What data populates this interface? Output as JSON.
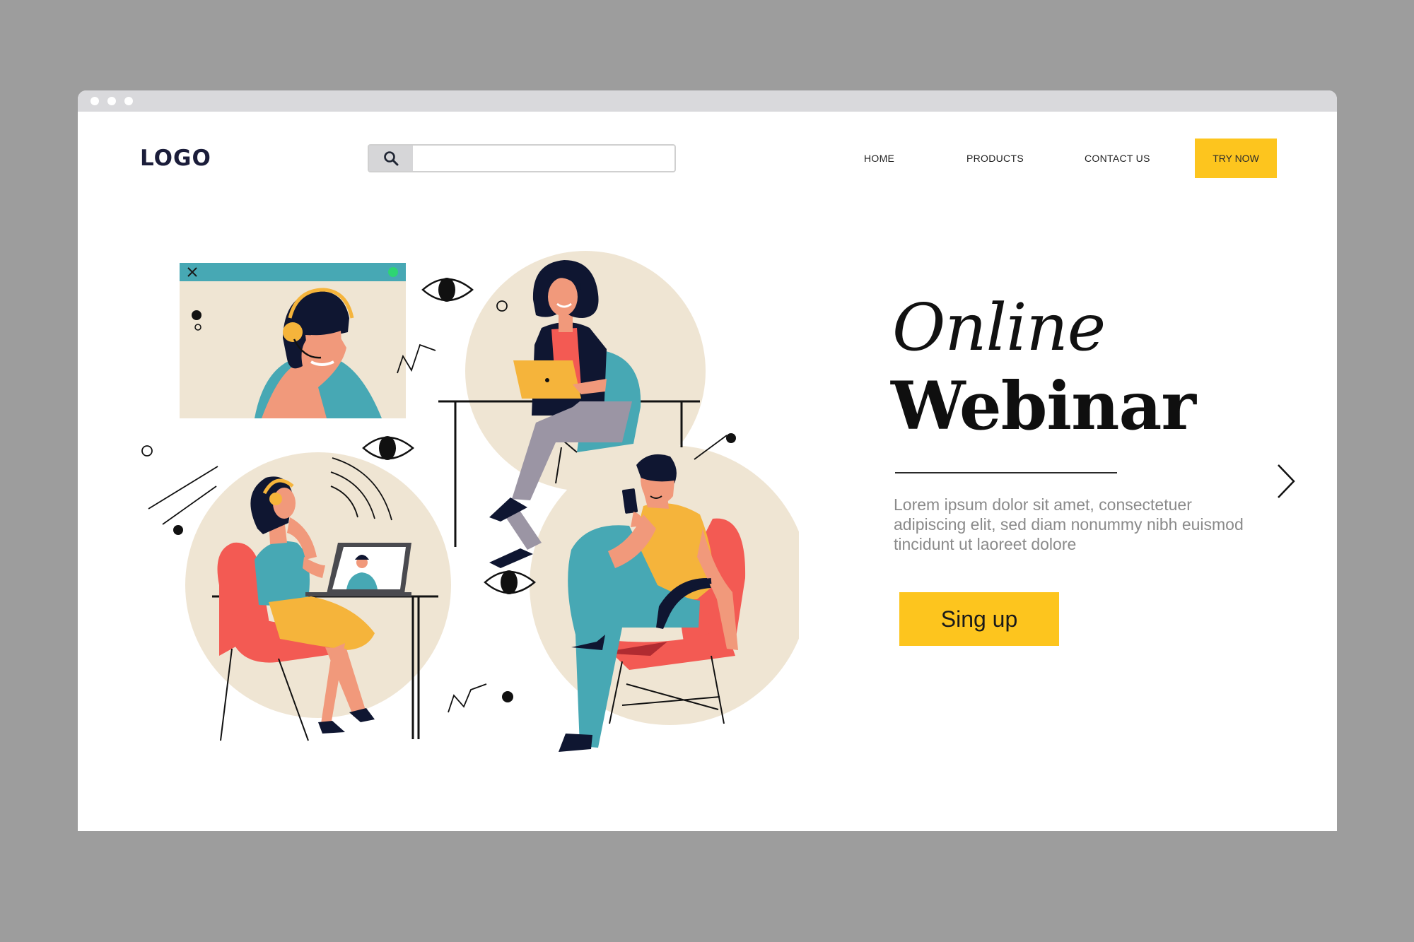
{
  "header": {
    "logo": "LOGO",
    "search": {
      "placeholder": ""
    },
    "nav": [
      {
        "label": "HOME"
      },
      {
        "label": "PRODUCTS"
      },
      {
        "label": "CONTACT US"
      }
    ],
    "cta": "TRY NOW"
  },
  "hero": {
    "title_line1": "Online",
    "title_line2": "Webinar",
    "description": "Lorem ipsum dolor sit amet, consectetuer adipiscing elit, sed diam nonummy nibh euismod tincidunt ut laoreet dolore",
    "button": "Sing up"
  },
  "icons": {
    "search": "search-icon",
    "next": "chevron-right-icon",
    "close": "close-icon"
  },
  "colors": {
    "accent": "#fdc51e",
    "frame": "#9d9d9d",
    "titlebar": "#d9d9dc",
    "circle": "#efe5d3",
    "teal": "#47a8b4",
    "red": "#f35a53",
    "navy": "#0f1631",
    "skin": "#f1997b"
  }
}
